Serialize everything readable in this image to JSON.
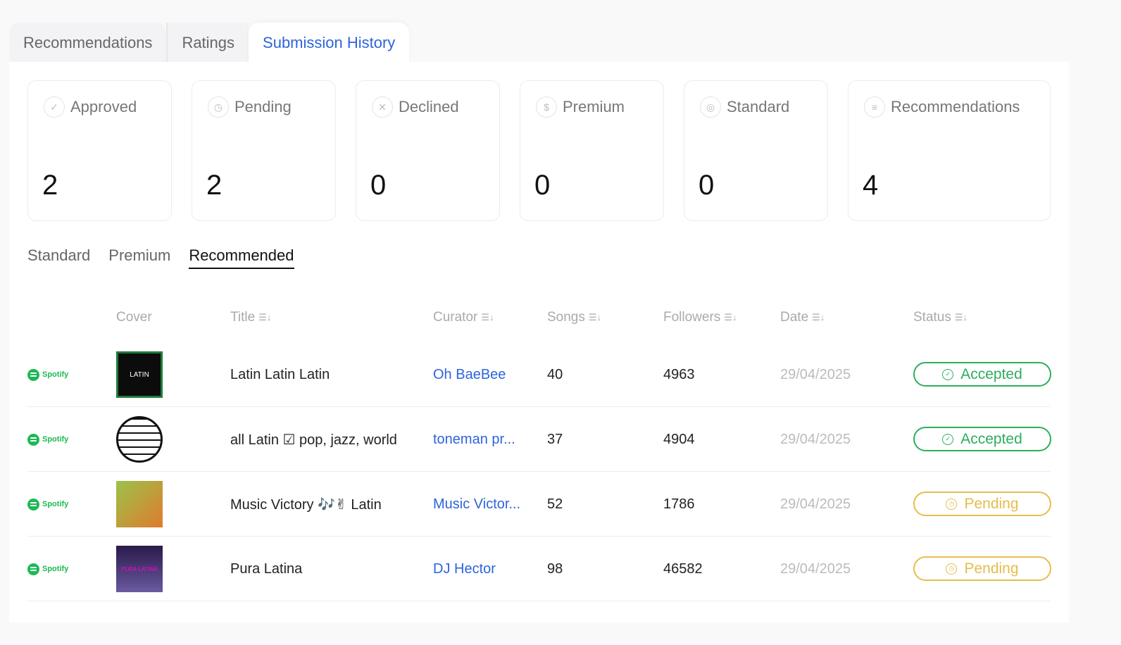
{
  "tabs": [
    {
      "label": "Recommendations"
    },
    {
      "label": "Ratings"
    },
    {
      "label": "Submission History"
    }
  ],
  "stats": [
    {
      "label": "Approved",
      "value": "2",
      "icon": "check-circle-icon"
    },
    {
      "label": "Pending",
      "value": "2",
      "icon": "clock-icon"
    },
    {
      "label": "Declined",
      "value": "0",
      "icon": "x-circle-icon"
    },
    {
      "label": "Premium",
      "value": "0",
      "icon": "dollar-circle-icon"
    },
    {
      "label": "Standard",
      "value": "0",
      "icon": "target-circle-icon"
    },
    {
      "label": "Recommendations",
      "value": "4",
      "icon": "list-circle-icon"
    }
  ],
  "subtabs": [
    {
      "label": "Standard"
    },
    {
      "label": "Premium"
    },
    {
      "label": "Recommended"
    }
  ],
  "table": {
    "headers": {
      "cover": "Cover",
      "title": "Title",
      "curator": "Curator",
      "songs": "Songs",
      "followers": "Followers",
      "date": "Date",
      "status": "Status"
    },
    "platform_label": "Spotify",
    "rows": [
      {
        "title": "Latin Latin Latin",
        "curator": "Oh BaeBee",
        "songs": "40",
        "followers": "4963",
        "date": "29/04/2025",
        "status": "Accepted",
        "cover_text": "LATIN"
      },
      {
        "title": "all Latin ☑ pop, jazz, world",
        "curator": "toneman pr...",
        "songs": "37",
        "followers": "4904",
        "date": "29/04/2025",
        "status": "Accepted",
        "cover_text": ""
      },
      {
        "title": "Music Victory 🎶✌ Latin",
        "curator": "Music Victor...",
        "songs": "52",
        "followers": "1786",
        "date": "29/04/2025",
        "status": "Pending",
        "cover_text": ""
      },
      {
        "title": "Pura Latina",
        "curator": "DJ Hector",
        "songs": "98",
        "followers": "46582",
        "date": "29/04/2025",
        "status": "Pending",
        "cover_text": "PURA LATINA"
      }
    ]
  },
  "colors": {
    "accent": "#2e64dc",
    "accepted": "#2cae5c",
    "pending": "#e6bd4b",
    "spotify": "#1db954"
  }
}
